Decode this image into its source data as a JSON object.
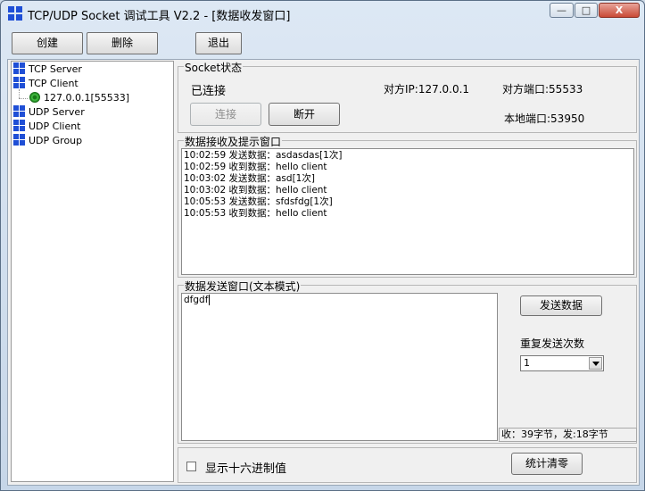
{
  "window": {
    "title": "TCP/UDP Socket 调试工具 V2.2 - [数据收发窗口]",
    "controls": {
      "minimize": "—",
      "maximize": "□",
      "close": "X"
    }
  },
  "toolbar": {
    "create": "创建",
    "delete": "删除",
    "exit": "退出"
  },
  "tree": {
    "tcp_server": "TCP Server",
    "tcp_client": "TCP Client",
    "connection": "127.0.0.1[55533]",
    "udp_server": "UDP Server",
    "udp_client": "UDP Client",
    "udp_group": "UDP Group"
  },
  "socket_status": {
    "legend": "Socket状态",
    "state": "已连接",
    "remote_ip": "对方IP:127.0.0.1",
    "remote_port": "对方端口:55533",
    "local_port": "本地端口:53950",
    "connect_button": "连接",
    "disconnect_button": "断开"
  },
  "receive": {
    "legend": "数据接收及提示窗口",
    "lines": [
      "10:02:59 发送数据：asdasdas[1次]",
      "10:02:59 收到数据：hello client",
      "10:03:02 发送数据：asd[1次]",
      "10:03:02 收到数据：hello client",
      "10:05:53 发送数据：sfdsfdg[1次]",
      "10:05:53 收到数据：hello client"
    ]
  },
  "send": {
    "legend": "数据发送窗口(文本模式)",
    "content": "dfgdf",
    "send_button": "发送数据",
    "repeat_label": "重复发送次数",
    "repeat_value": "1",
    "stats": "收：39字节，发:18字节"
  },
  "bottom": {
    "hex_label": "显示十六进制值",
    "clear_button": "统计清零"
  },
  "colors": {
    "logo": "#1f4fd6",
    "status_ok": "#2fb12f"
  },
  "icons": {
    "app": "windows-logo-icon",
    "node": "windows-logo-icon",
    "connection": "connected-status-icon"
  }
}
